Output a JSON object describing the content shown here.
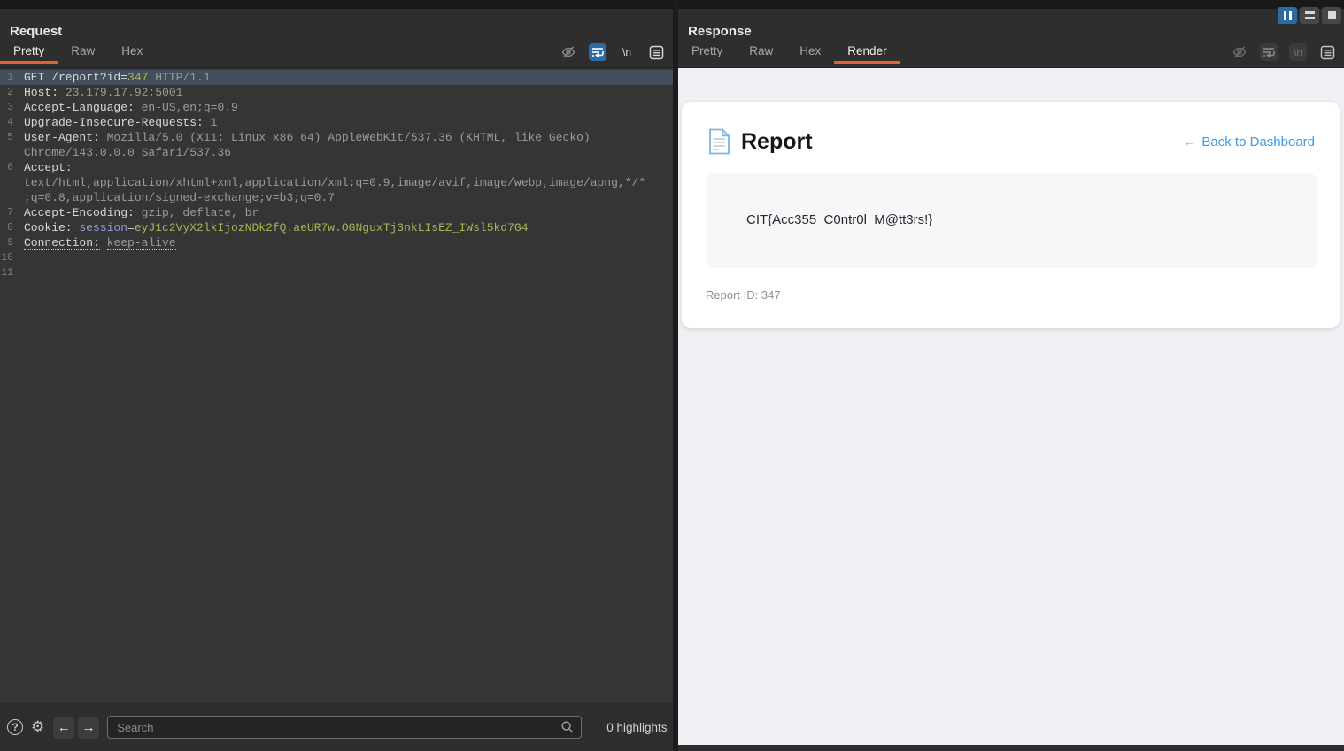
{
  "window": {
    "layout_buttons": [
      "columns-layout",
      "rows-layout",
      "single-layout"
    ]
  },
  "request": {
    "title": "Request",
    "tabs": [
      {
        "label": "Pretty",
        "active": true
      },
      {
        "label": "Raw",
        "active": false
      },
      {
        "label": "Hex",
        "active": false
      }
    ],
    "editor_lines": [
      {
        "num": "1",
        "highlight": true,
        "tokens": [
          {
            "c": "name",
            "t": "GET /report?id="
          },
          {
            "c": "value",
            "t": "347"
          },
          {
            "c": "dim",
            "t": " HTTP/1.1"
          }
        ]
      },
      {
        "num": "2",
        "tokens": [
          {
            "c": "name",
            "t": "Host:"
          },
          {
            "c": "dim",
            "t": " 23.179.17.92:5001"
          }
        ]
      },
      {
        "num": "3",
        "tokens": [
          {
            "c": "name",
            "t": "Accept-Language:"
          },
          {
            "c": "dim",
            "t": " en-US,en;q=0.9"
          }
        ]
      },
      {
        "num": "4",
        "tokens": [
          {
            "c": "name",
            "t": "Upgrade-Insecure-Requests:"
          },
          {
            "c": "dim",
            "t": " 1"
          }
        ]
      },
      {
        "num": "5",
        "tokens": [
          {
            "c": "name",
            "t": "User-Agent:"
          },
          {
            "c": "dim",
            "t": " Mozilla/5.0 (X11; Linux x86_64) AppleWebKit/537.36 (KHTML, like Gecko)"
          }
        ]
      },
      {
        "num": "",
        "tokens": [
          {
            "c": "dim",
            "t": "Chrome/143.0.0.0 Safari/537.36"
          }
        ]
      },
      {
        "num": "6",
        "tokens": [
          {
            "c": "name",
            "t": "Accept:"
          }
        ]
      },
      {
        "num": "",
        "tokens": [
          {
            "c": "dim",
            "t": "text/html,application/xhtml+xml,application/xml;q=0.9,image/avif,image/webp,image/apng,*/*"
          }
        ]
      },
      {
        "num": "",
        "tokens": [
          {
            "c": "dim",
            "t": ";q=0.8,application/signed-exchange;v=b3;q=0.7"
          }
        ]
      },
      {
        "num": "7",
        "tokens": [
          {
            "c": "name",
            "t": "Accept-Encoding:"
          },
          {
            "c": "dim",
            "t": " gzip, deflate, br"
          }
        ]
      },
      {
        "num": "8",
        "tokens": [
          {
            "c": "name",
            "t": "Cookie:"
          },
          {
            "c": "plain",
            "t": " "
          },
          {
            "c": "param",
            "t": "session"
          },
          {
            "c": "plain",
            "t": "="
          },
          {
            "c": "value",
            "t": "eyJ1c2VyX2lkIjozNDk2fQ.aeUR7w.OGNguxTj3nkLIsEZ_IWsl5kd7G4"
          }
        ]
      },
      {
        "num": "9",
        "tokens": [
          {
            "c": "name dotted",
            "t": "Connection:"
          },
          {
            "c": "plain",
            "t": " "
          },
          {
            "c": "dim dotted",
            "t": "keep-alive"
          }
        ]
      },
      {
        "num": "10",
        "tokens": []
      },
      {
        "num": "11",
        "tokens": []
      }
    ],
    "search": {
      "placeholder": "Search",
      "highlights": "0 highlights"
    }
  },
  "response": {
    "title": "Response",
    "tabs": [
      {
        "label": "Pretty",
        "active": false
      },
      {
        "label": "Raw",
        "active": false
      },
      {
        "label": "Hex",
        "active": false
      },
      {
        "label": "Render",
        "active": true
      }
    ],
    "render": {
      "heading": "Report",
      "back_arrow": "←",
      "back_link": "Back to Dashboard",
      "flag": "CIT{Acc355_C0ntr0l_M@tt3rs!}",
      "report_id": "Report ID: 347"
    }
  },
  "icons": {
    "help": "?",
    "gear": "⚙",
    "prev_arrow": "←",
    "next_arrow": "→",
    "newline": "\\n"
  },
  "colors": {
    "accent_orange": "#e4632a",
    "active_blue": "#2d6ba3",
    "link_blue": "#3f9ae0",
    "value_green": "#abb456",
    "param_blue": "#8f9ed8",
    "line_highlight": "#424e5b"
  }
}
